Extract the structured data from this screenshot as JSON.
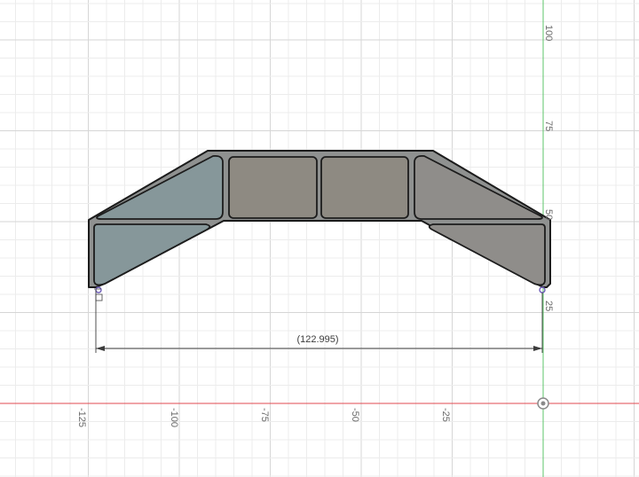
{
  "viewport": {
    "x_axis_labels": [
      "-125",
      "-100",
      "-75",
      "-50",
      "-25"
    ],
    "y_axis_labels": [
      "100",
      "75",
      "50",
      "25"
    ],
    "dimension_label": "(122.995)",
    "colors": {
      "background": "#ffffff",
      "grid_minor": "#ececec",
      "grid_major": "#d6d6d6",
      "x_axis": "#e0484f",
      "y_axis": "#5cc46a",
      "body_fill": "#8f9190",
      "cavity_fill_left": "#86979a",
      "cavity_fill_mid": "#8e8a82",
      "cavity_fill_right": "#8f8d8a",
      "outline": "#1c1c1c",
      "dimension": "#3c3c3c",
      "origin_marker": "#8a8a8a",
      "sketch_point": "#6d5cb8"
    },
    "icons": [
      "origin-marker-icon",
      "sketch-point-icon",
      "constraint-glyph-icon"
    ]
  }
}
